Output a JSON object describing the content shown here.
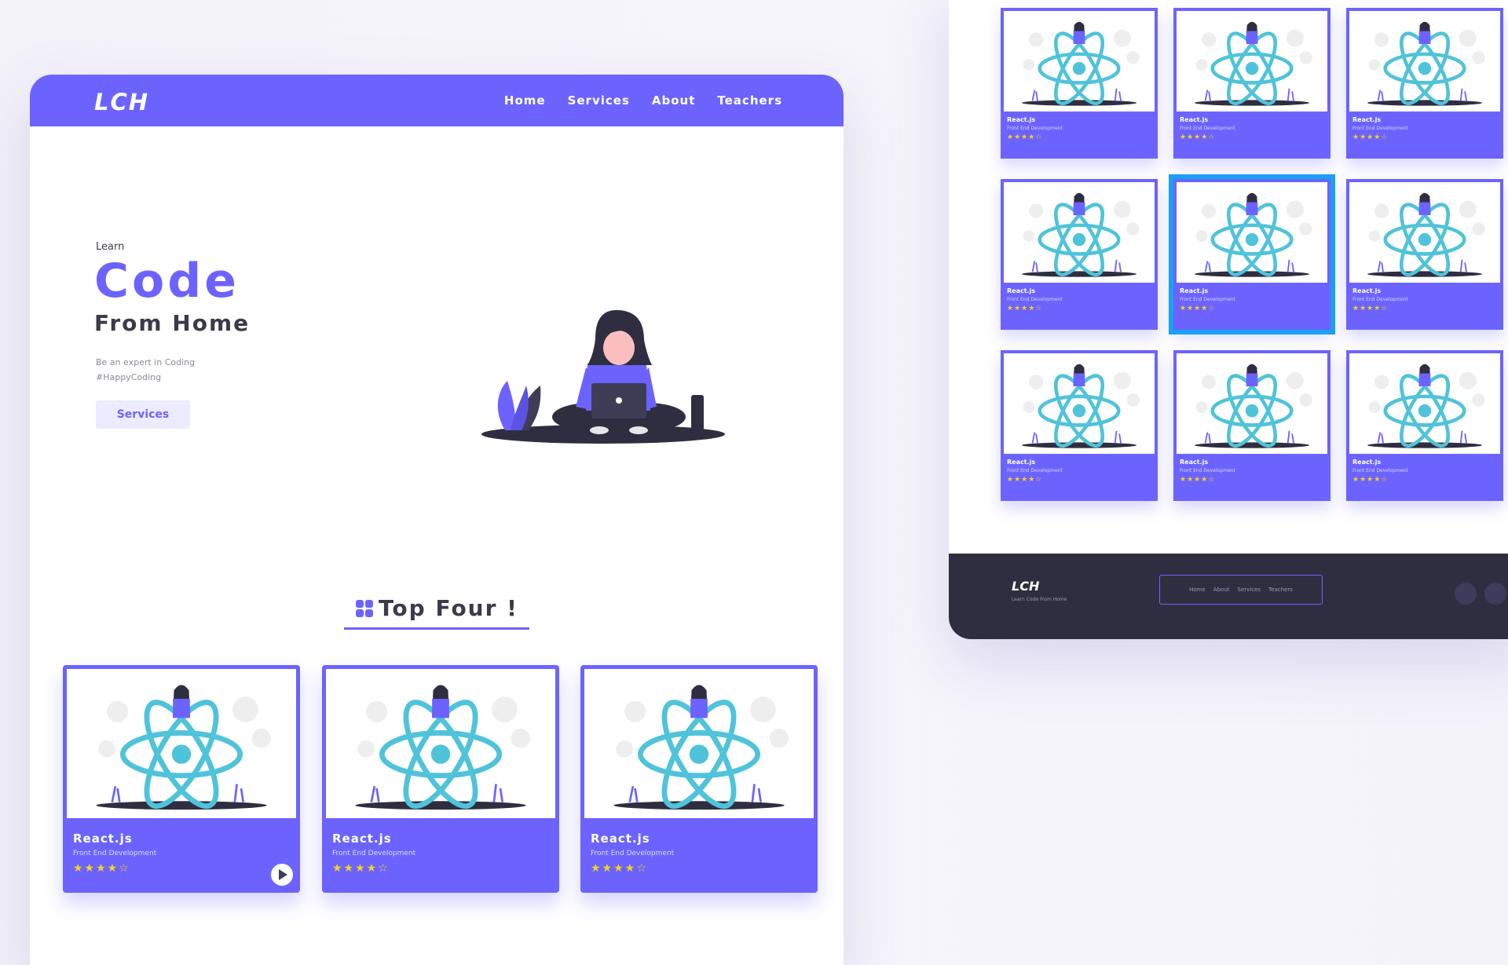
{
  "left": {
    "logo": "LCH",
    "nav": [
      "Home",
      "Services",
      "About",
      "Teachers"
    ],
    "hero": {
      "kicker": "Learn",
      "title": "Code",
      "subtitle": "From Home",
      "desc_line1": "Be an expert in Coding",
      "desc_line2": "#HappyCoding",
      "button": "Services"
    },
    "section_title": "Top Four !",
    "cards": [
      {
        "name": "React.js",
        "sub": "Front End Development",
        "stars": "★★★★☆"
      },
      {
        "name": "React.js",
        "sub": "Front End Development",
        "stars": "★★★★☆"
      },
      {
        "name": "React.js",
        "sub": "Front End Development",
        "stars": "★★★★☆"
      }
    ]
  },
  "right": {
    "cards": [
      {
        "name": "React.js",
        "sub": "Front End Development",
        "stars": "★★★★☆"
      },
      {
        "name": "React.js",
        "sub": "Front End Development",
        "stars": "★★★★☆"
      },
      {
        "name": "React.js",
        "sub": "Front End Development",
        "stars": "★★★★☆"
      },
      {
        "name": "React.js",
        "sub": "Front End Development",
        "stars": "★★★★☆"
      },
      {
        "name": "React.js",
        "sub": "Front End Development",
        "stars": "★★★★☆"
      },
      {
        "name": "React.js",
        "sub": "Front End Development",
        "stars": "★★★★☆"
      },
      {
        "name": "React.js",
        "sub": "Front End Development",
        "stars": "★★★★☆"
      },
      {
        "name": "React.js",
        "sub": "Front End Development",
        "stars": "★★★★☆"
      },
      {
        "name": "React.js",
        "sub": "Front End Development",
        "stars": "★★★★☆"
      }
    ],
    "footer": {
      "logo": "LCH",
      "tagline": "Learn Code From Home",
      "nav": [
        "Home",
        "About",
        "Services",
        "Teachers"
      ]
    }
  },
  "colors": {
    "accent": "#6c63ff",
    "dark": "#2f2e41",
    "star": "#f7d21c",
    "selection": "#1aa0f5"
  },
  "icons": [
    "grid-icon",
    "play-icon",
    "react-atom-icon",
    "girl-laptop-illustration"
  ]
}
